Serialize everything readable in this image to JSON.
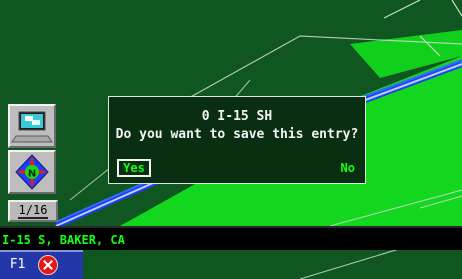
{
  "dialog": {
    "title": "0 I-15 SH",
    "question": "Do you want to save this entry?",
    "yes_label": "Yes",
    "no_label": "No"
  },
  "map": {
    "scale_label": "1/16",
    "computer_icon": "computer-icon",
    "compass_icon": "compass-icon",
    "colors": {
      "dark_green": "#0f5620",
      "bright_green": "#12d71e",
      "road_blue": "#2f6dff"
    }
  },
  "street_bar": {
    "text": "I-15 S, BAKER, CA"
  },
  "footer": {
    "f1_label": "F1",
    "close_icon": "close-icon"
  }
}
